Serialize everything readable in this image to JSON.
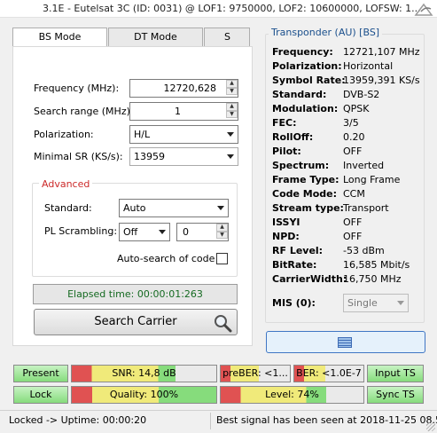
{
  "window": {
    "title": "3.1E - Eutelsat 3C (ID: 0031) @ LOF1: 9750000, LOF2: 10600000, LOFSW: 1..."
  },
  "tabs": [
    {
      "label": "BS Mode"
    },
    {
      "label": "DT Mode"
    },
    {
      "label": "S"
    }
  ],
  "bs_mode": {
    "frequency": {
      "label": "Frequency (MHz):",
      "value": "12720,628"
    },
    "search_range": {
      "label": "Search range (MHz):",
      "value": "1"
    },
    "polarization": {
      "label": "Polarization:",
      "value": "H/L"
    },
    "min_sr": {
      "label": "Minimal SR (KS/s):",
      "value": "13959"
    },
    "advanced": {
      "title": "Advanced",
      "standard": {
        "label": "Standard:",
        "value": "Auto"
      },
      "pl_scrambling": {
        "label": "PL Scrambling:",
        "mode": "Off",
        "value": "0"
      },
      "auto_search": {
        "label": "Auto-search of code",
        "checked": false
      }
    },
    "elapsed": "Elapsed time: 00:00:01:263",
    "search_button": "Search Carrier"
  },
  "transponder": {
    "title": "Transponder (AU) [BS]",
    "fields": [
      {
        "key": "Frequency:",
        "value": "12721,107 MHz"
      },
      {
        "key": "Polarization:",
        "value": "Horizontal"
      },
      {
        "key": "Symbol Rate:",
        "value": "13959,391 KS/s"
      },
      {
        "key": "Standard:",
        "value": "DVB-S2"
      },
      {
        "key": "Modulation:",
        "value": "QPSK"
      },
      {
        "key": "FEC:",
        "value": "3/5"
      },
      {
        "key": "RollOff:",
        "value": "0.20"
      },
      {
        "key": "Pilot:",
        "value": "OFF"
      },
      {
        "key": "Spectrum:",
        "value": "Inverted"
      },
      {
        "key": "Frame Type:",
        "value": "Long Frame"
      },
      {
        "key": "Code Mode:",
        "value": "CCM"
      },
      {
        "key": "Stream type:",
        "value": "Transport"
      },
      {
        "key": "ISSYI",
        "value": "OFF"
      },
      {
        "key": "NPD:",
        "value": "OFF"
      },
      {
        "key": "RF Level:",
        "value": "-53 dBm"
      },
      {
        "key": "BitRate:",
        "value": "16,585 Mbit/s"
      },
      {
        "key": "CarrierWidth:",
        "value": "16,750 MHz"
      }
    ],
    "mis": {
      "label": "MIS (0):",
      "value": "Single"
    }
  },
  "indicators": {
    "row1": {
      "present": "Present",
      "snr": {
        "text": "SNR: 14,8 dB",
        "level": 0.72
      },
      "preber": {
        "text": "preBER: <1...",
        "level": 0.55
      },
      "ber": {
        "text": "BER: <1.0E-7",
        "level": 0.45
      },
      "input_ts": "Input TS"
    },
    "row2": {
      "lock": "Lock",
      "quality": {
        "text": "Quality: 100%",
        "level": 1.0
      },
      "level": {
        "text": "Level: 74%",
        "level": 0.74
      },
      "sync_ts": "Sync TS"
    }
  },
  "status": {
    "left": "Locked -> Uptime: 00:00:20",
    "right": "Best signal has been seen at 2018-11-25 08.5..."
  },
  "colors": {
    "accent_blue": "#1a4f8c",
    "advanced_red": "#cc2a2a",
    "ok_green": "#86dc7c",
    "meter_red": "#e05252",
    "meter_yellow": "#f0ea7a"
  }
}
